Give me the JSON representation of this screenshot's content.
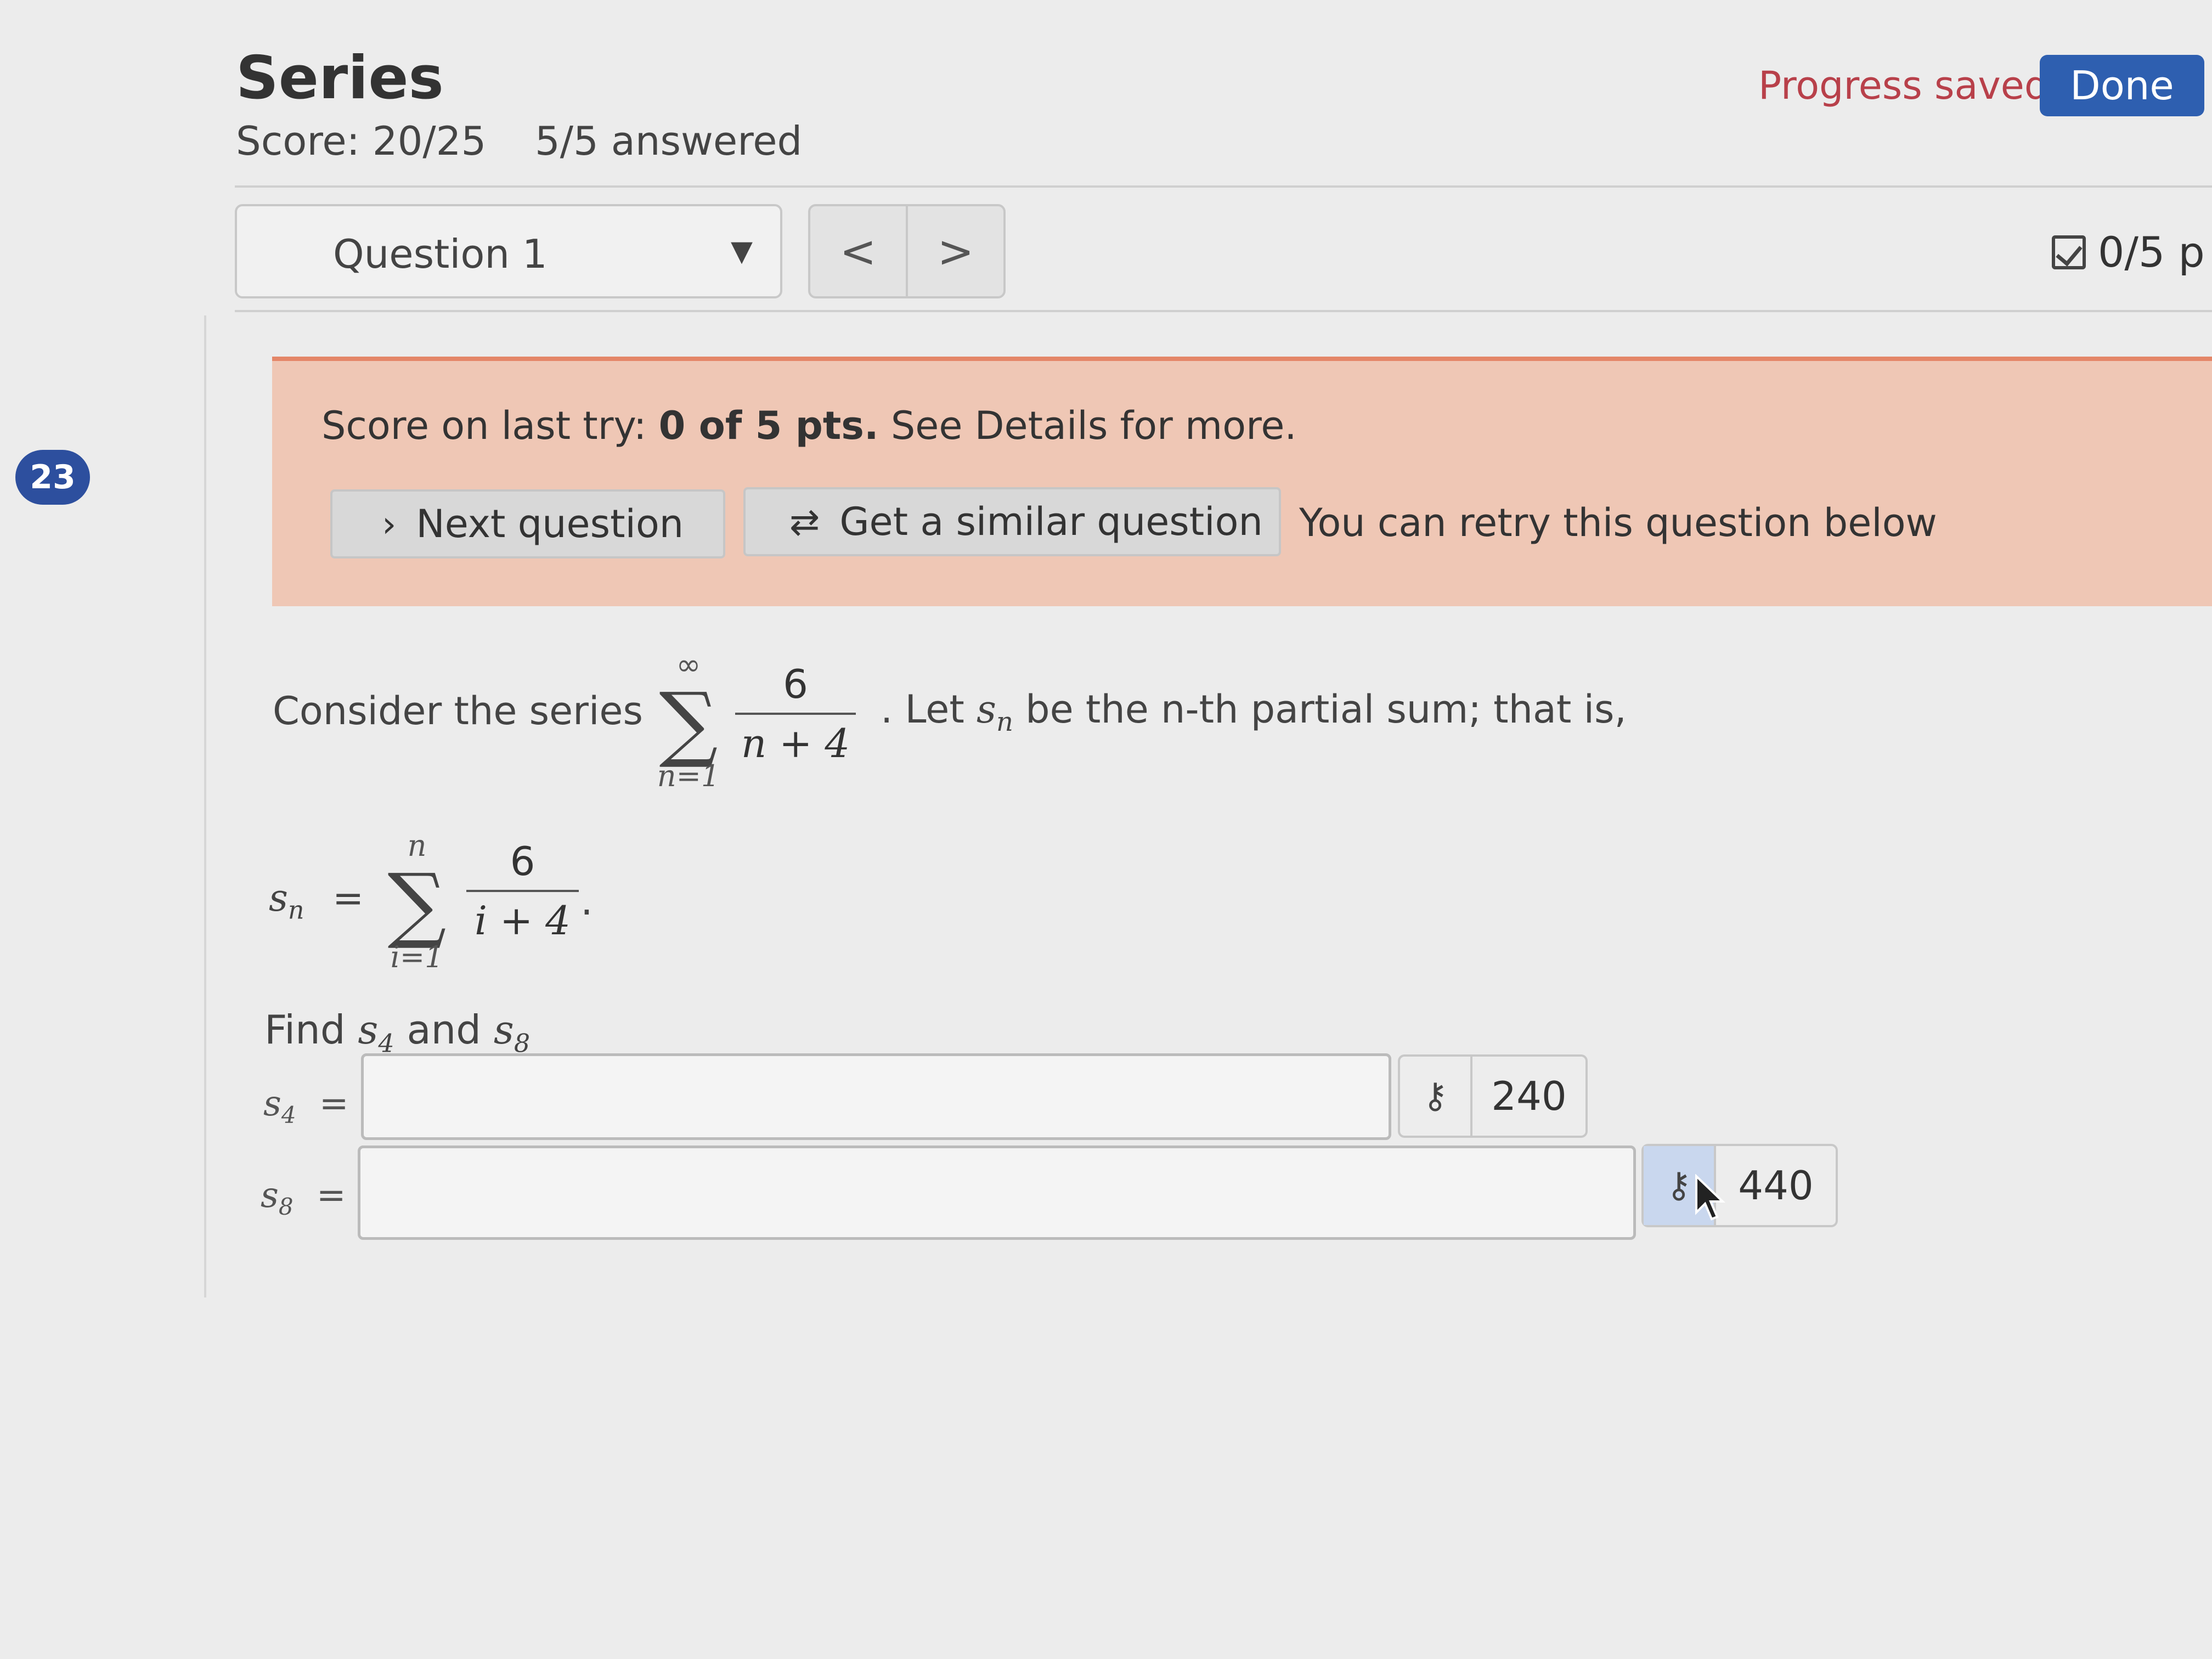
{
  "header": {
    "title": "Series",
    "score": "Score: 20/25",
    "answered": "5/5 answered",
    "progress_text": "Progress saved",
    "done_label": "Done"
  },
  "nav": {
    "question_select": "Question 1",
    "prev_glyph": "<",
    "next_glyph": ">",
    "points": "0/5 p"
  },
  "side_badge": "23",
  "banner": {
    "score_prefix": "Score on last try: ",
    "score_bold": "0 of 5 pts.",
    "score_suffix": " See Details for more.",
    "next_label": "Next question",
    "similar_label": "Get a similar question",
    "retry_text": "You can retry this question below"
  },
  "question": {
    "intro": "Consider the series",
    "sum1_upper": "∞",
    "sum1_lower": "n=1",
    "sum1_num": "6",
    "sum1_den": "n + 4",
    "after_sum": ". Let ",
    "sn_var": "s",
    "sn_sub": "n",
    "after_sn": " be the n-th partial sum; that is,",
    "sn_lhs": "s",
    "sn_lhs_sub": "n",
    "equals": "=",
    "sum2_upper": "n",
    "sum2_lower": "i=1",
    "sum2_num": "6",
    "sum2_den": "i + 4",
    "sum2_end": ".",
    "find_prefix": "Find ",
    "find_s4": "s",
    "find_s4_sub": "4",
    "find_and": " and ",
    "find_s8": "s",
    "find_s8_sub": "8"
  },
  "answers": [
    {
      "label": "s",
      "sub": "4",
      "eq": "=",
      "value": "",
      "key_icon": "key-icon",
      "key_value": "240"
    },
    {
      "label": "s",
      "sub": "8",
      "eq": "=",
      "value": "",
      "key_icon": "key-icon",
      "key_value": "440"
    }
  ]
}
